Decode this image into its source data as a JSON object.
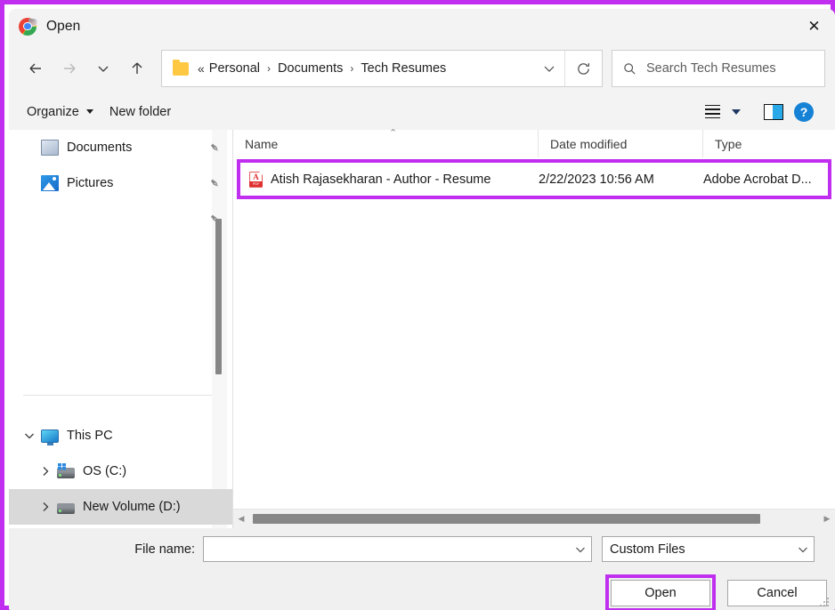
{
  "window": {
    "title": "Open",
    "app_icon": "chrome-icon",
    "close_label": "✕",
    "annotation_color": "#c02ff0"
  },
  "navigation": {
    "back_label": "←",
    "forward_label": "→",
    "recent_label": "⌄",
    "up_label": "↑",
    "breadcrumb": {
      "folder_icon": "folder-icon",
      "ellipsis": "«",
      "items": [
        "Personal",
        "Documents",
        "Tech Resumes"
      ],
      "separator": "›",
      "dropdown_label": "⌄"
    },
    "refresh_label": "refresh-icon"
  },
  "search": {
    "icon": "search-icon",
    "placeholder": "Search Tech Resumes",
    "value": ""
  },
  "toolbar": {
    "organize_label": "Organize",
    "new_folder_label": "New folder",
    "view_icon": "list-view-icon",
    "view_dropdown": "chevron-down-icon",
    "preview_pane_icon": "preview-pane-icon",
    "help_label": "?"
  },
  "sidebar": {
    "quick_access": [
      {
        "label": "Documents",
        "icon": "documents-icon",
        "pin": "✒",
        "pinned": true
      },
      {
        "label": "Pictures",
        "icon": "pictures-icon",
        "pin": "✒",
        "pinned": true
      },
      {
        "label": "",
        "icon": "",
        "pin": "✒",
        "pinned": true
      }
    ],
    "tree": [
      {
        "label": "This PC",
        "icon": "this-pc-icon",
        "chevron": "⌄",
        "expanded": true,
        "selected": false,
        "indent": 0
      },
      {
        "label": "OS (C:)",
        "icon": "drive-os-icon",
        "chevron": "›",
        "expanded": false,
        "selected": false,
        "indent": 1
      },
      {
        "label": "New Volume (D:)",
        "icon": "drive-icon",
        "chevron": "›",
        "expanded": false,
        "selected": true,
        "indent": 1
      }
    ]
  },
  "filelist": {
    "columns": [
      {
        "key": "name",
        "label": "Name",
        "sorted": true,
        "sort_caret": "⌃"
      },
      {
        "key": "date",
        "label": "Date modified",
        "sorted": false
      },
      {
        "key": "type",
        "label": "Type",
        "sorted": false
      }
    ],
    "rows": [
      {
        "name": "Atish Rajasekharan - Author - Resume",
        "date": "2/22/2023 10:56 AM",
        "type": "Adobe Acrobat D...",
        "icon": "pdf-file-icon",
        "icon_tag": "PDF",
        "icon_letter": "A",
        "highlighted": true
      }
    ],
    "hscroll": {
      "left_arrow": "◀",
      "right_arrow": "▶"
    }
  },
  "footer": {
    "file_name_label": "File name:",
    "file_name_value": "",
    "file_name_caret": "⌄",
    "file_type_value": "Custom Files",
    "file_type_caret": "⌄",
    "open_label": "Open",
    "cancel_label": "Cancel"
  }
}
